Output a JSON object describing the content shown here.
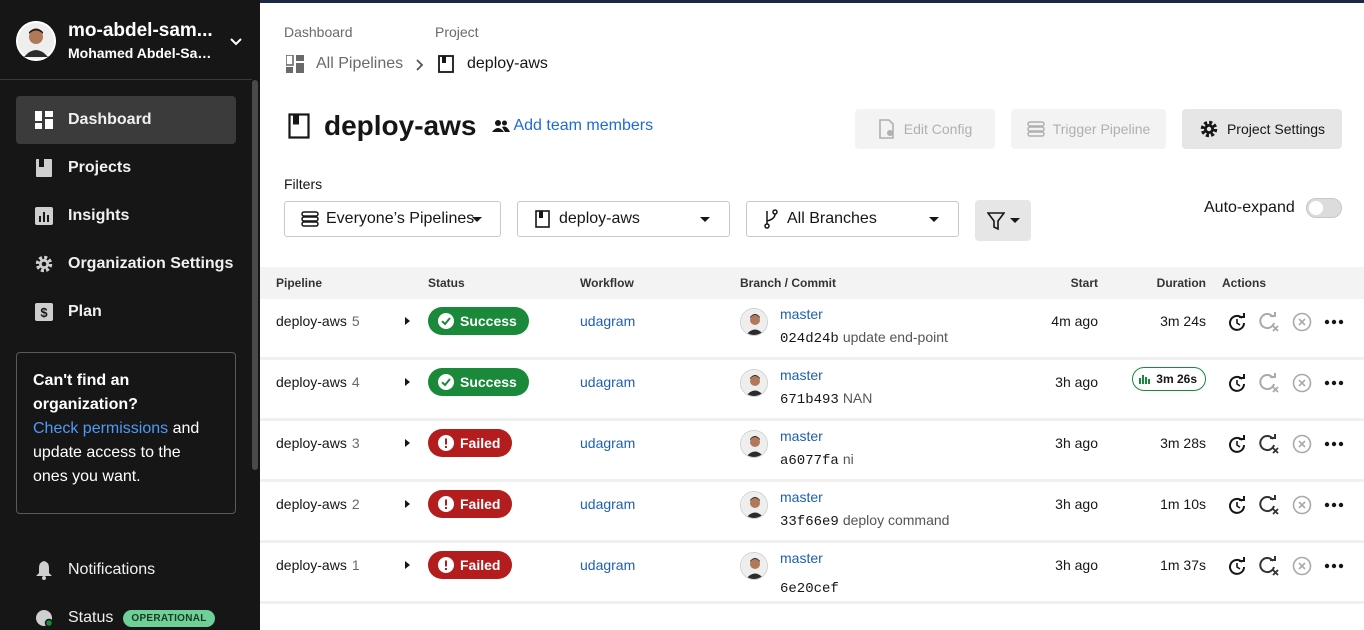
{
  "org": {
    "name": "mo-abdel-sam...",
    "full_name": "Mohamed Abdel-Sam..."
  },
  "sidebar": {
    "items": [
      {
        "label": "Dashboard",
        "icon": "dashboard-icon",
        "active": true
      },
      {
        "label": "Projects",
        "icon": "projects-icon"
      },
      {
        "label": "Insights",
        "icon": "insights-icon"
      },
      {
        "label": "Organization Settings",
        "icon": "gear-icon"
      },
      {
        "label": "Plan",
        "icon": "dollar-icon"
      }
    ],
    "cant_find": {
      "title": "Can't find an organization?",
      "link": "Check permissions",
      "rest": " and update access to the ones you want."
    },
    "notifications": "Notifications",
    "status": "Status",
    "status_badge": "OPERATIONAL"
  },
  "breadcrumb": {
    "dashboard_label": "Dashboard",
    "dashboard_value": "All Pipelines",
    "project_label": "Project",
    "project_value": "deploy-aws"
  },
  "header": {
    "title": "deploy-aws",
    "add_team": "Add team members",
    "edit_config": "Edit Config",
    "trigger_pipeline": "Trigger Pipeline",
    "project_settings": "Project Settings"
  },
  "filters": {
    "label": "Filters",
    "pipelines": "Everyone’s Pipelines",
    "project": "deploy-aws",
    "branches": "All Branches",
    "auto_expand": "Auto-expand"
  },
  "table": {
    "headers": [
      "Pipeline",
      "Status",
      "Workflow",
      "Branch / Commit",
      "Start",
      "Duration",
      "Actions"
    ],
    "rows": [
      {
        "pipeline": "deploy-aws",
        "num": "5",
        "status": "Success",
        "workflow": "udagram",
        "branch": "master",
        "hash": "024d24b",
        "msg": "update end-point",
        "start": "4m ago",
        "duration": "3m 24s"
      },
      {
        "pipeline": "deploy-aws",
        "num": "4",
        "status": "Success",
        "workflow": "udagram",
        "branch": "master",
        "hash": "671b493",
        "msg": "NAN",
        "start": "3h ago",
        "duration": "3m 26s"
      },
      {
        "pipeline": "deploy-aws",
        "num": "3",
        "status": "Failed",
        "workflow": "udagram",
        "branch": "master",
        "hash": "a6077fa",
        "msg": "ni",
        "start": "3h ago",
        "duration": "3m 28s"
      },
      {
        "pipeline": "deploy-aws",
        "num": "2",
        "status": "Failed",
        "workflow": "udagram",
        "branch": "master",
        "hash": "33f66e9",
        "msg": "deploy command",
        "start": "3h ago",
        "duration": "1m 10s"
      },
      {
        "pipeline": "deploy-aws",
        "num": "1",
        "status": "Failed",
        "workflow": "udagram",
        "branch": "master",
        "hash": "6e20cef",
        "msg": "",
        "start": "3h ago",
        "duration": "1m 37s"
      }
    ]
  },
  "colors": {
    "success": "#1a8a3a",
    "failed": "#b31d1d",
    "link": "#1e5fb3",
    "sidebar": "#161616"
  }
}
